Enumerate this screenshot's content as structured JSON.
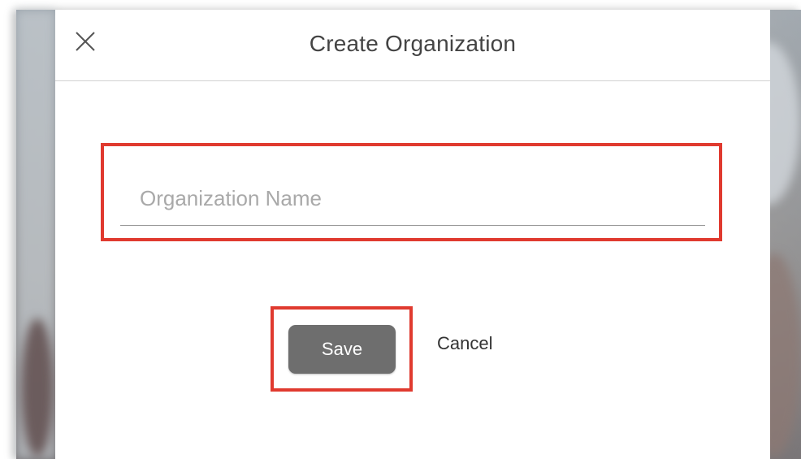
{
  "dialog": {
    "title": "Create Organization",
    "close_icon": "close-icon"
  },
  "form": {
    "org_name_placeholder": "Organization Name",
    "org_name_value": ""
  },
  "actions": {
    "save_label": "Save",
    "cancel_label": "Cancel"
  },
  "colors": {
    "highlight": "#e03a2f",
    "save_button": "#6e6e6e",
    "title_text": "#444444",
    "placeholder_text": "#a9a9a9"
  }
}
